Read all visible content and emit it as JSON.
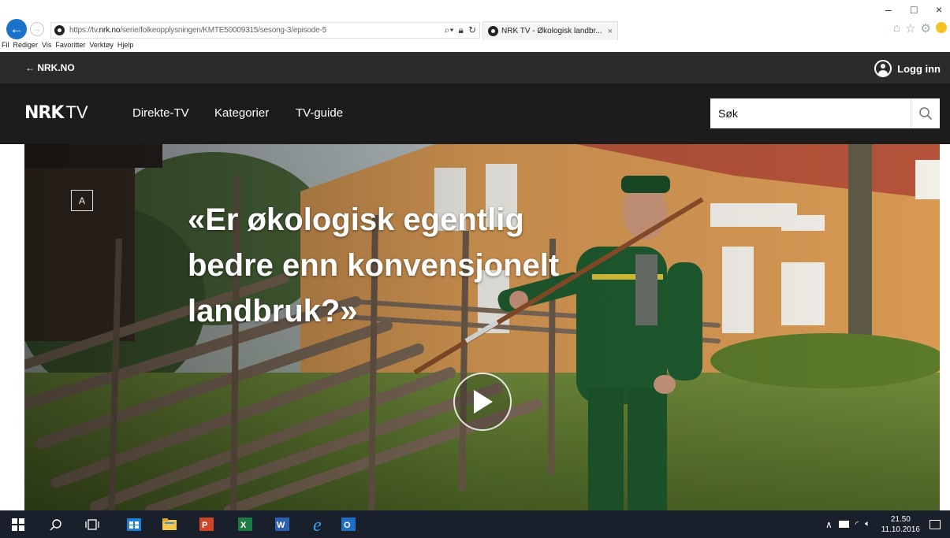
{
  "browser": {
    "url_prefix": "https://tv.",
    "url_domain": "nrk.no",
    "url_path": "/serie/folkeopplysningen/KMTE50009315/sesong-3/episode-5",
    "tab_title": "NRK TV - Økologisk landbr...",
    "tab_close": "×",
    "menu": [
      "Fil",
      "Rediger",
      "Vis",
      "Favoritter",
      "Verktøy",
      "Hjelp"
    ],
    "window_controls": [
      "–",
      "□",
      "×"
    ]
  },
  "nrk_topbar": {
    "back_link": "← NRK.NO",
    "login": "Logg inn"
  },
  "nav": {
    "logo_nrk": "NRK",
    "logo_tv": "TV",
    "items": [
      "Direkte-TV",
      "Kategorier",
      "TV-guide"
    ],
    "search_placeholder": "Søk"
  },
  "hero": {
    "age_rating": "A",
    "title": "«Er økologisk egentlig bedre enn konvensjonelt landbruk?»"
  },
  "taskbar": {
    "time": "21.50",
    "date": "11.10.2016"
  },
  "colors": {
    "nrk_topbar": "#2b2b2b",
    "nrk_nav": "#1c1c1c",
    "taskbar": "#1a1f2c",
    "ie_blue": "#1a73c9"
  }
}
